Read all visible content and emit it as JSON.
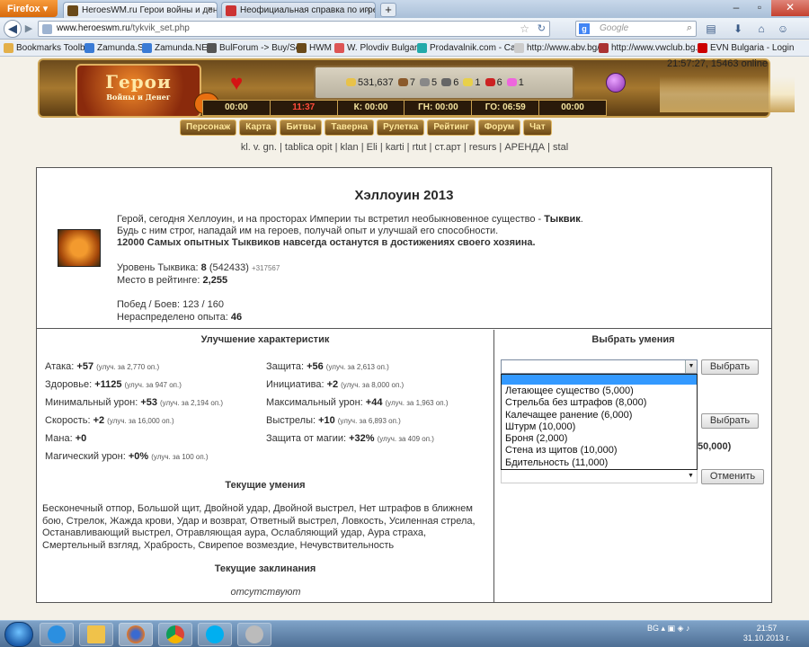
{
  "browser": {
    "app_button": "Firefox",
    "tabs": [
      {
        "title": "HeroesWM.ru Герои войны и денег. ..."
      },
      {
        "title": "Неофициальная справка по игре Н..."
      }
    ],
    "new_tab": "+",
    "url_domain": "www.heroeswm.ru",
    "url_path": "/tykvik_set.php",
    "search_placeholder": "Google"
  },
  "bookmarks": [
    "Bookmarks Toolbar",
    "Zamunda.SE",
    "Zamunda.NET",
    "BulForum -> Buy/Sell",
    "HWM",
    "W. Plovdiv Bulgaria",
    "Prodavalnik.com - Ca...",
    "http://www.abv.bg/",
    "http://www.vwclub.bg...",
    "EVN Bulgaria - Login"
  ],
  "header": {
    "server_time": "21:57:27, 15463 online",
    "logo_text": "Герои",
    "logo_sub": "Войны и Денег",
    "resources": [
      "531,637",
      "7",
      "5",
      "6",
      "1",
      "6",
      "1"
    ],
    "timers": [
      "00:00",
      "11:37",
      "К: 00:00",
      "ГН: 00:00",
      "ГО: 06:59",
      "00:00"
    ],
    "timer_prefix": "",
    "menu": [
      "Персонаж",
      "Карта",
      "Битвы",
      "Таверна",
      "Рулетка",
      "Рейтинг",
      "Форум",
      "Чат"
    ],
    "sublinks": "kl. v. gn. | tablica opit | klan | Eli | karti | rtut | ст.арт | resurs | АРЕНДА | stal"
  },
  "main": {
    "title": "Хэллоуин 2013",
    "desc1": "Герой, сегодня Хеллоуин, и на просторах Империи ты встретил необыкновенное существо - ",
    "desc1_bold": "Тыквик",
    "desc1_end": ".",
    "desc2": "Будь с ним строг, нападай им на героев, получай опыт и улучшай его способности.",
    "desc3": "12000 Самых опытных Тыквиков навсегда останутся в достижениях своего хозяина.",
    "level_label": "Уровень Тыквика: ",
    "level_value": "8",
    "level_exp": " (542433) ",
    "level_next": "+317567",
    "rank_label": "Место в рейтинге: ",
    "rank_value": "2,255",
    "wins_label": "Побед / Боев: 123 / 160",
    "unspent_label": "Нераспределено опыта: ",
    "unspent_value": "46"
  },
  "stats": {
    "heading": "Улучшение характеристик",
    "left": [
      {
        "label": "Атака: ",
        "value": "+57",
        "note": "(улуч. за 2,770 оп.)"
      },
      {
        "label": "Здоровье: ",
        "value": "+1125",
        "note": "(улуч. за 947 оп.)"
      },
      {
        "label": "Минимальный урон: ",
        "value": "+53",
        "note": "(улуч. за 2,194 оп.)"
      },
      {
        "label": "Скорость: ",
        "value": "+2",
        "note": "(улуч. за 16,000 оп.)"
      },
      {
        "label": "Мана: ",
        "value": "+0",
        "note": ""
      },
      {
        "label": "Магический урон: ",
        "value": "+0%",
        "note": "(улуч. за 100 оп.)"
      }
    ],
    "right": [
      {
        "label": "Защита: ",
        "value": "+56",
        "note": "(улуч. за 2,613 оп.)"
      },
      {
        "label": "Инициатива: ",
        "value": "+2",
        "note": "(улуч. за 8,000 оп.)"
      },
      {
        "label": "Максимальный урон: ",
        "value": "+44",
        "note": "(улуч. за 1,963 оп.)"
      },
      {
        "label": "Выстрелы: ",
        "value": "+10",
        "note": "(улуч. за 6,893 оп.)"
      },
      {
        "label": "Защита от магии: ",
        "value": "+32%",
        "note": "(улуч. за 409 оп.)"
      }
    ]
  },
  "skills": {
    "heading": "Текущие умения",
    "text": "Бесконечный отпор, Большой щит, Двойной удар, Двойной выстрел, Нет штрафов в ближнем бою, Стрелок, Жажда крови, Удар и возврат, Ответный выстрел, Ловкость, Усиленная стрела, Останавливающий выстрел, Отравляющая аура, Ослабляющий удар, Аура страха, Смертельный взгляд, Храбрость, Свирепое возмездие, Нечувствительность"
  },
  "spells": {
    "heading": "Текущие заклинания",
    "none": "отсутствуют"
  },
  "choose": {
    "heading": "Выбрать умения",
    "btn_select1": "Выбрать",
    "btn_select2": "Выбрать",
    "btn_cancel": "Отменить",
    "partial_text": "50,000)",
    "options": [
      "Летающее существо (5,000)",
      "Стрельба без штрафов (8,000)",
      "Калечащее ранение (6,000)",
      "Штурм (10,000)",
      "Броня (2,000)",
      "Стена из щитов (10,000)",
      "Бдительность (11,000)"
    ]
  },
  "taskbar": {
    "lang": "BG",
    "time": "21:57",
    "date": "31.10.2013 г."
  }
}
